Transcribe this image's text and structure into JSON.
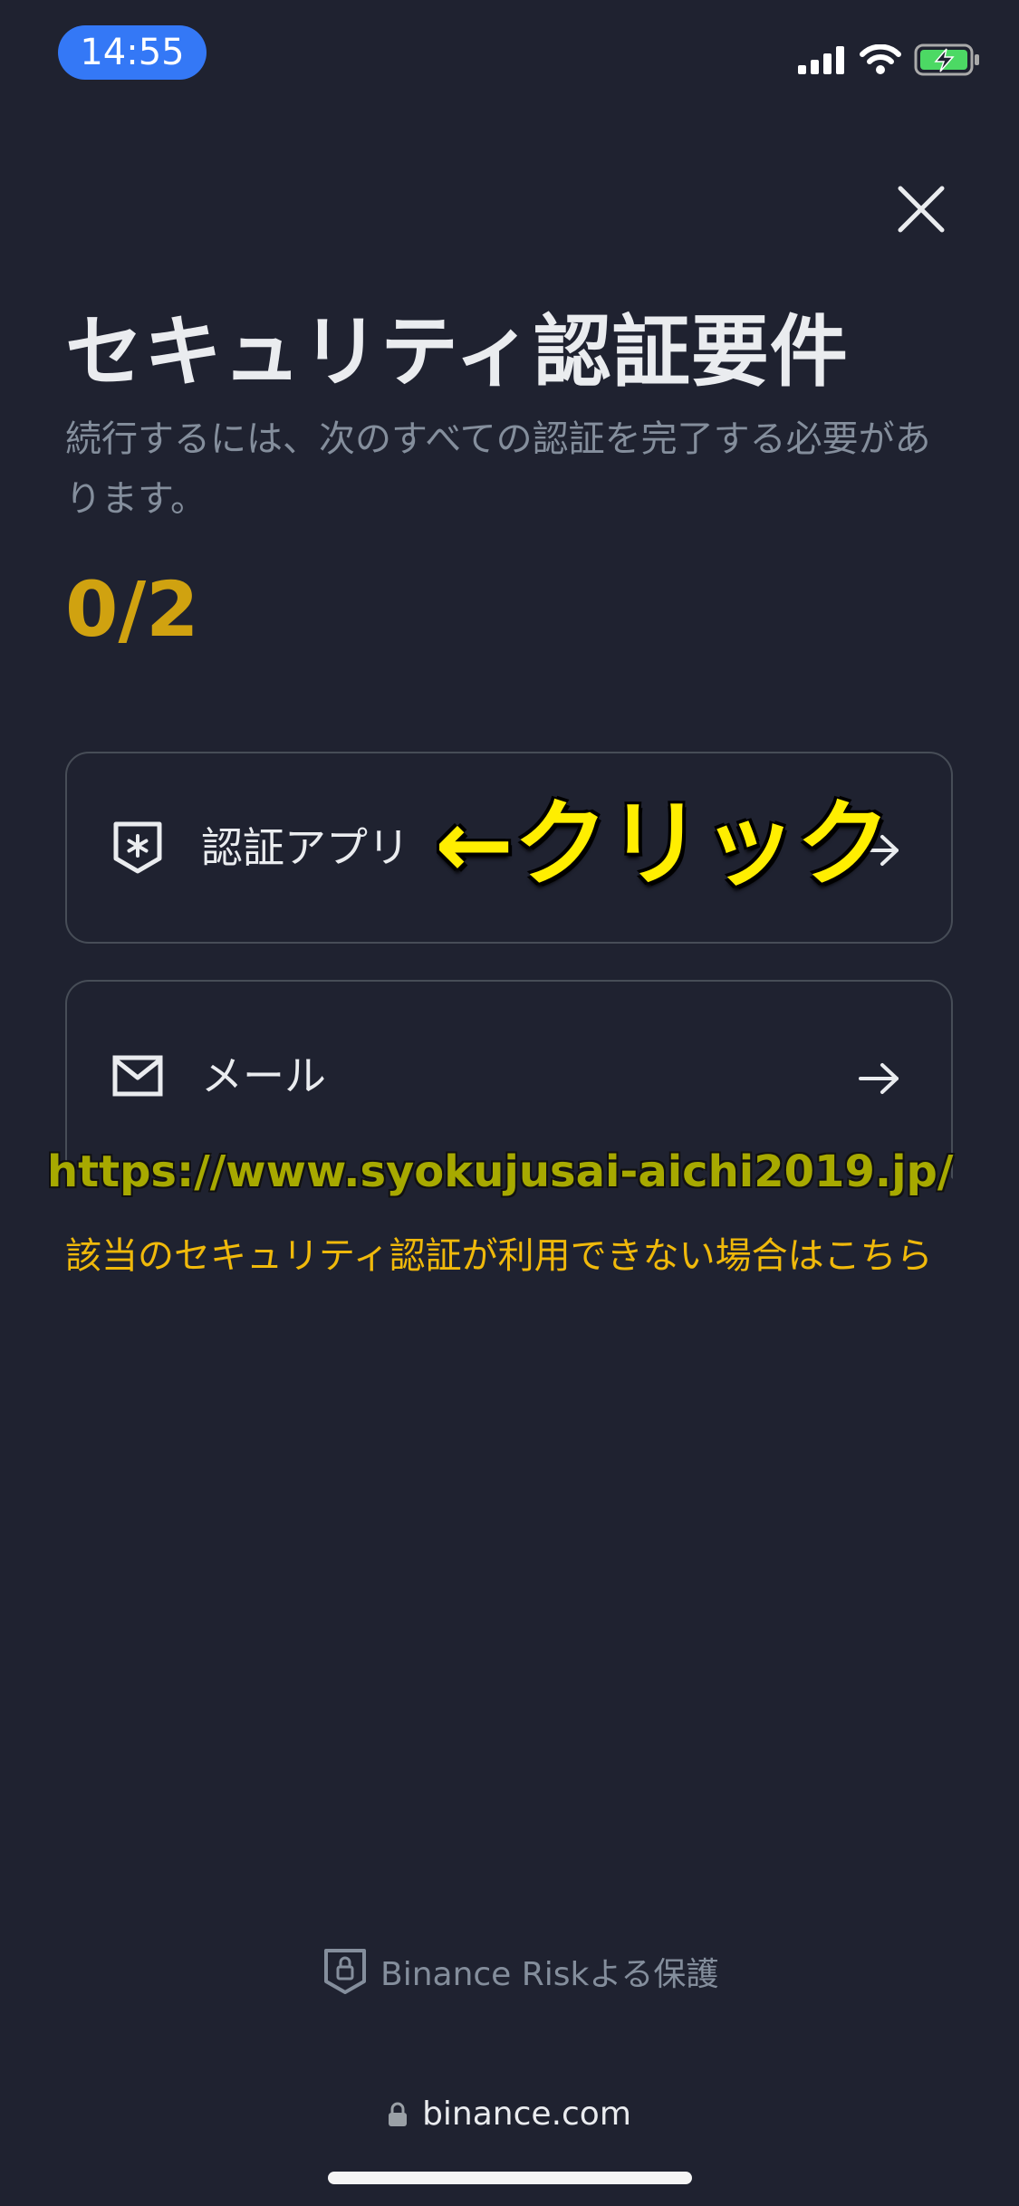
{
  "status_bar": {
    "time": "14:55"
  },
  "header": {
    "close_icon": "close-icon"
  },
  "page": {
    "title": "セキュリティ認証要件",
    "subtitle": "続行するには、次のすべての認証を完了する必要があります。",
    "progress": "0/2"
  },
  "options": [
    {
      "label": "認証アプリ",
      "icon": "shield-asterisk-icon"
    },
    {
      "label": "メール",
      "icon": "mail-icon"
    }
  ],
  "annotations": {
    "click": "←クリック",
    "url": "https://www.syokujusai-aichi2019.jp/"
  },
  "help_link": "該当のセキュリティ認証が利用できない場合はこちら",
  "footer": {
    "protection": "Binance Riskよる保護",
    "domain": "binance.com"
  },
  "colors": {
    "accent": "#f0b90b",
    "background": "#1f2230",
    "time_pill": "#3478f6"
  }
}
